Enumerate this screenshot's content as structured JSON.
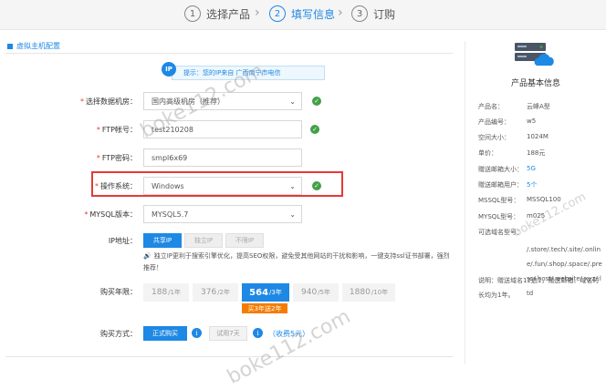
{
  "steps": [
    {
      "num": "1",
      "label": "选择产品"
    },
    {
      "num": "2",
      "label": "填写信息"
    },
    {
      "num": "3",
      "label": "订购"
    }
  ],
  "section_title": "虚拟主机配置",
  "ip_notice": "提示：您的IP来自 广西南宁市电信",
  "form": {
    "datacenter": {
      "label": "选择数据机房：",
      "value": "国内高级机房（推荐）"
    },
    "ftp_account": {
      "label": "FTP帐号：",
      "value": "test210208"
    },
    "ftp_password": {
      "label": "FTP密码：",
      "value": "smpl6x69"
    },
    "os": {
      "label": "操作系统：",
      "value": "Windows"
    },
    "mysql": {
      "label": "MYSQL版本：",
      "value": "MYSQL5.7"
    },
    "ip": {
      "label": "IP地址：",
      "options": [
        "共享IP",
        "独立IP",
        "不限IP"
      ],
      "note": "独立IP更利于搜索引擎优化，提高SEO权限，避免受其他网站的干扰和影响，一键支持ssl证书部署，强烈推荐！"
    },
    "period": {
      "label": "购买年限：",
      "options": [
        {
          "price": "188",
          "unit": "/1年"
        },
        {
          "price": "376",
          "unit": "/2年"
        },
        {
          "price": "564",
          "unit": "/3年"
        },
        {
          "price": "940",
          "unit": "/5年"
        },
        {
          "price": "1880",
          "unit": "/10年"
        }
      ],
      "selected_index": 2,
      "promo": "买3年送2年"
    },
    "purchase": {
      "label": "购买方式：",
      "formal": "正式购买",
      "trial": "试用7天",
      "reward": "（收费5元）"
    }
  },
  "product": {
    "title": "产品基本信息",
    "specs": [
      {
        "k": "产品名：",
        "v": "云峰A型"
      },
      {
        "k": "产品编号：",
        "v": "w5"
      },
      {
        "k": "空间大小：",
        "v": "1024M"
      },
      {
        "k": "单价：",
        "v": "188元"
      },
      {
        "k": "赠送邮箱大小：",
        "v": "5G"
      },
      {
        "k": "赠送邮箱用户：",
        "v": "5个"
      },
      {
        "k": "MSSQL型号：",
        "v": "MSSQL100"
      },
      {
        "k": "MYSQL型号：",
        "v": "m025"
      },
      {
        "k": "可选域名型号：",
        "v": ""
      }
    ],
    "domains": "/.store/.tech/.site/.online/.fun/.shop/.space/.press/.host/.website/.xyz/.ltd",
    "explain": "说明：赠送域名12选1，赠送邮箱、域名时长均为1年。"
  },
  "watermark": "boke112.com",
  "colors": {
    "accent": "#1e88e5",
    "ok": "#43a047",
    "alert": "#e53935",
    "promo": "#f57c00"
  }
}
